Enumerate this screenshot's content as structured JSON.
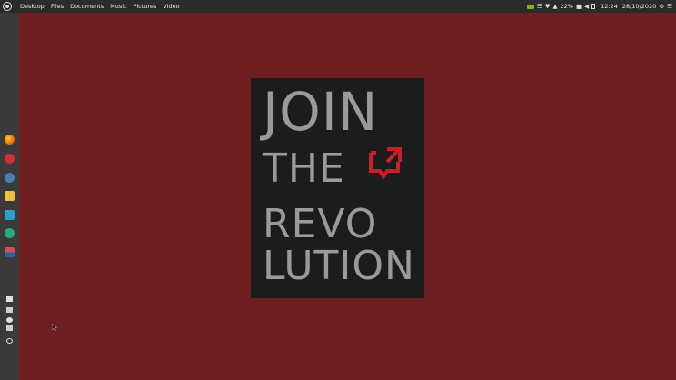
{
  "topbar": {
    "places": [
      "Desktop",
      "Files",
      "Documents",
      "Music",
      "Pictures",
      "Video"
    ],
    "battery": "22%",
    "time": "12:24",
    "date": "28/10/2020"
  },
  "dock": {
    "apps": [
      "firefox",
      "app-red",
      "settings",
      "mail",
      "multitask",
      "media",
      "java"
    ],
    "bottom": [
      "folder",
      "terminal",
      "user",
      "trash",
      "settings"
    ]
  },
  "poster": {
    "line1": "JOIN",
    "line2": "THE",
    "line3": "REVO",
    "line4": "LUTION",
    "accent_color": "#c8202a"
  },
  "colors": {
    "desktop_bg": "#6f1f22",
    "panel_bg": "#2b2b2b",
    "poster_bg": "#1c1c1c",
    "poster_text": "#9a9a9a"
  }
}
